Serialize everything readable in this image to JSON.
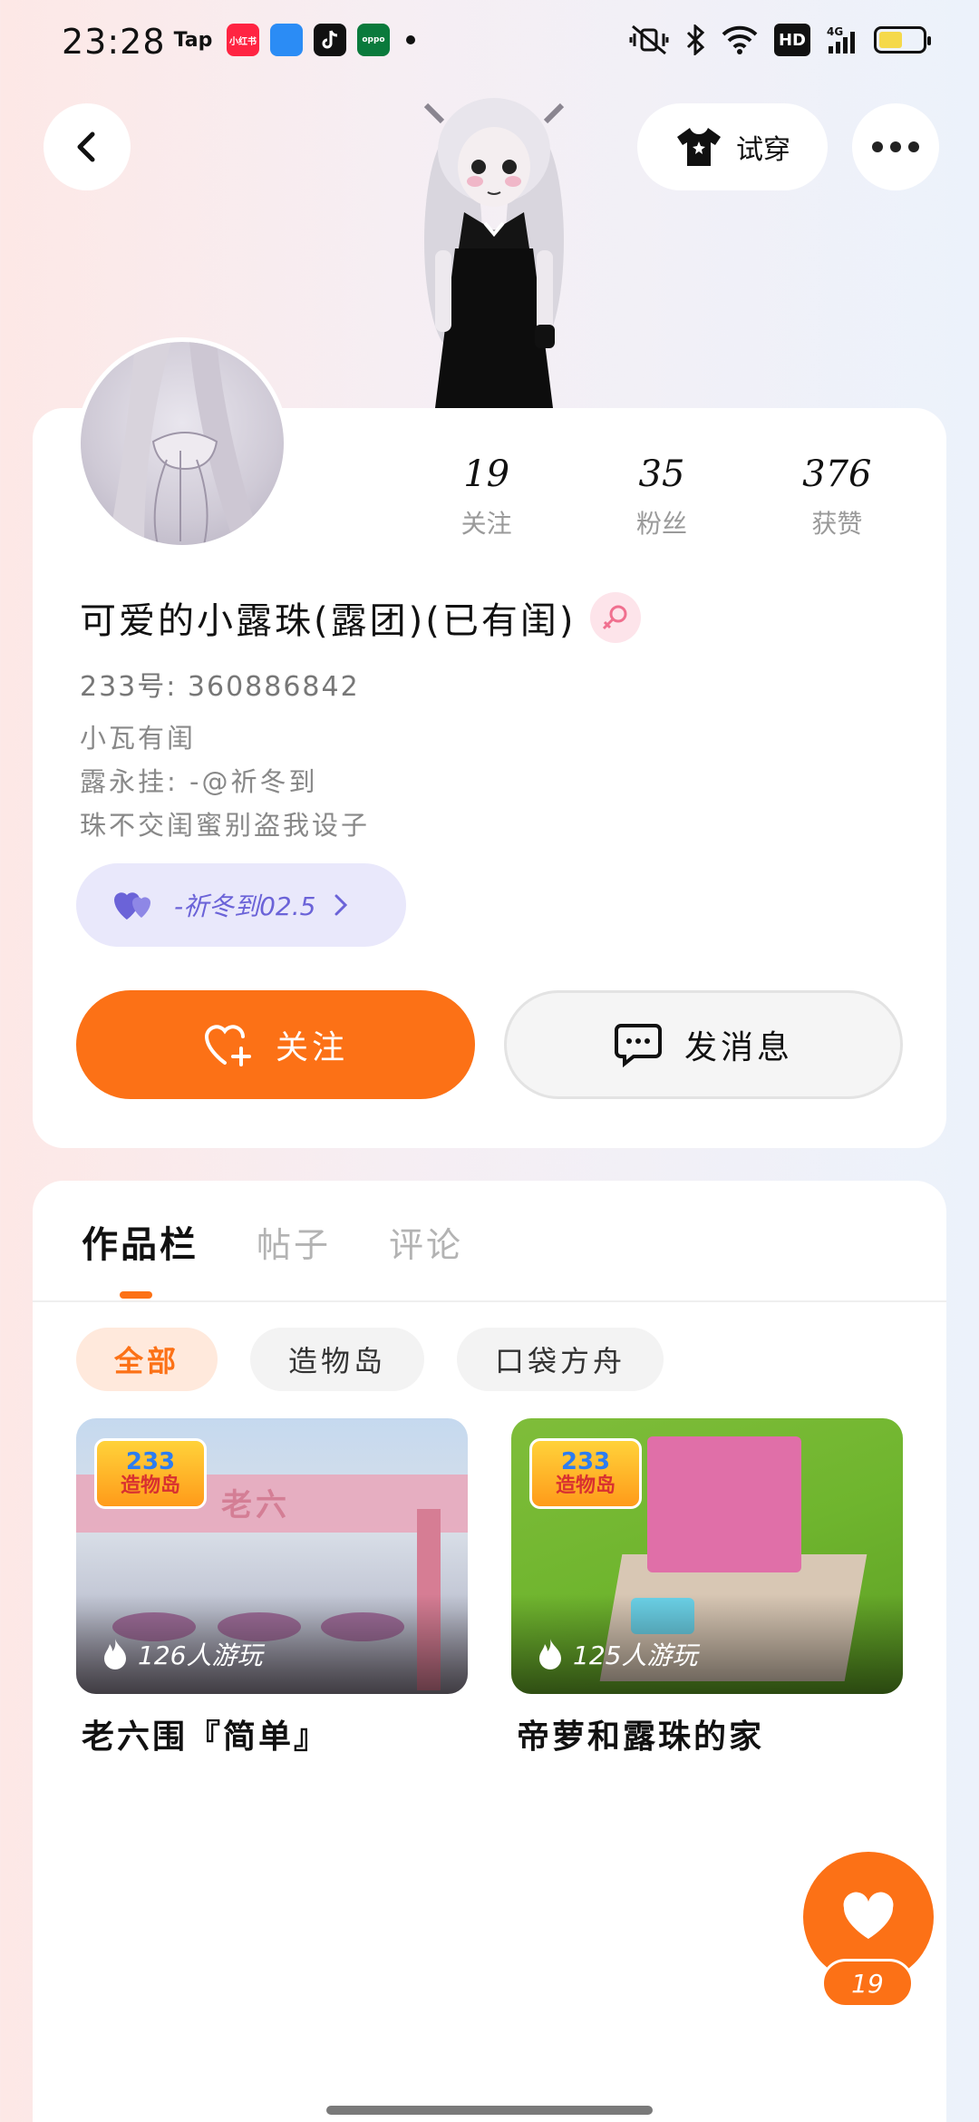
{
  "status_bar": {
    "time": "23:28",
    "apps": [
      "Tap",
      "小红书",
      "oppo"
    ],
    "hd": "HD",
    "network": "4G"
  },
  "header": {
    "tryon_label": "试穿"
  },
  "profile": {
    "stats": [
      {
        "value": "19",
        "label": "关注"
      },
      {
        "value": "35",
        "label": "粉丝"
      },
      {
        "value": "376",
        "label": "获赞"
      }
    ],
    "nickname": "可爱的小露珠(露团)(已有闺)",
    "user_id": "233号: 360886842",
    "bio": [
      "小瓦有闺",
      "露永挂: -@祈冬到",
      "珠不交闺蜜别盗我设子"
    ],
    "tag_label": "-祈冬到02.5",
    "follow_label": "关注",
    "message_label": "发消息"
  },
  "works": {
    "tabs": [
      {
        "label": "作品栏",
        "active": true
      },
      {
        "label": "帖子",
        "active": false
      },
      {
        "label": "评论",
        "active": false
      }
    ],
    "filters": [
      {
        "label": "全部",
        "active": true
      },
      {
        "label": "造物岛",
        "active": false
      },
      {
        "label": "口袋方舟",
        "active": false
      }
    ],
    "games": [
      {
        "logo_top": "233",
        "logo_bottom": "造物岛",
        "thumb_text": "老六",
        "plays": "126人游玩",
        "title": "老六围『简单』"
      },
      {
        "logo_top": "233",
        "logo_bottom": "造物岛",
        "plays": "125人游玩",
        "title": "帝萝和露珠的家"
      }
    ]
  },
  "fab": {
    "count": "19"
  }
}
